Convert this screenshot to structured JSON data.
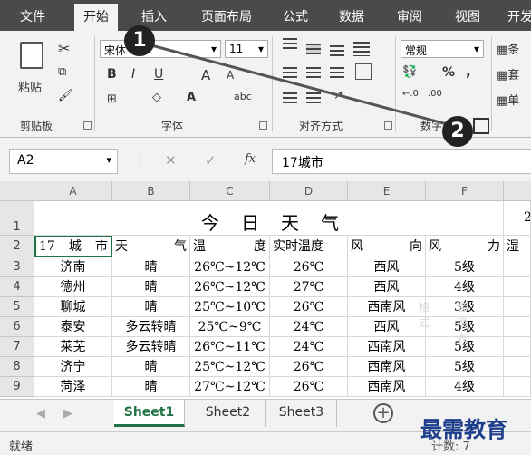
{
  "tabs": [
    "文件",
    "开始",
    "插入",
    "页面布局",
    "公式",
    "数据",
    "审阅",
    "视图",
    "开发"
  ],
  "ribbon": {
    "font_name": "宋体",
    "font_size": "11",
    "number_format": "常规",
    "paste_label": "粘贴",
    "percent": "%",
    "comma": ",",
    "bold": "B",
    "italic": "I",
    "underline": "U",
    "grow_font": "A",
    "shrink_font": "A",
    "font_color": "A",
    "styles": [
      "条",
      "套",
      "单"
    ],
    "groups": [
      "剪贴板",
      "字体",
      "对齐方式",
      "数字"
    ]
  },
  "formula_bar": {
    "name_box": "A2",
    "fx": "fx",
    "content": "17城市"
  },
  "columns": [
    "A",
    "B",
    "C",
    "D",
    "E",
    "F"
  ],
  "rows": [
    "1",
    "2",
    "3",
    "4",
    "5",
    "6",
    "7",
    "8",
    "9"
  ],
  "title": "今日天气",
  "g1_fragment": "2",
  "row2_headers": [
    {
      "l": "17",
      "m": "城",
      "r": "市"
    },
    {
      "l": "天",
      "m": "",
      "r": "气"
    },
    {
      "l": "温",
      "m": "",
      "r": "度"
    },
    {
      "l": "实时温度",
      "m": "",
      "r": ""
    },
    {
      "l": "风",
      "m": "",
      "r": "向"
    },
    {
      "l": "风",
      "m": "",
      "r": "力"
    },
    {
      "l": "湿",
      "m": "",
      "r": ""
    }
  ],
  "table": [
    [
      "济南",
      "晴",
      "26℃~12℃",
      "26℃",
      "西风",
      "5级"
    ],
    [
      "德州",
      "晴",
      "26℃~12℃",
      "27℃",
      "西风",
      "4级"
    ],
    [
      "聊城",
      "晴",
      "25℃~10℃",
      "26℃",
      "西南风",
      "3级"
    ],
    [
      "泰安",
      "多云转晴",
      "25℃~9℃",
      "24℃",
      "西风",
      "5级"
    ],
    [
      "莱芜",
      "多云转晴",
      "26℃~11℃",
      "24℃",
      "西南风",
      "5级"
    ],
    [
      "济宁",
      "晴",
      "25℃~12℃",
      "26℃",
      "西南风",
      "5级"
    ],
    [
      "菏泽",
      "晴",
      "27℃~12℃",
      "26℃",
      "西南风",
      "4级"
    ]
  ],
  "sheets": [
    "Sheet1",
    "Sheet2",
    "Sheet3"
  ],
  "status": {
    "ready": "就绪",
    "count": "计数: 7"
  },
  "callouts": [
    "1",
    "2"
  ],
  "faint_labels": [
    "格式",
    "套用表"
  ],
  "watermark": "最需教育"
}
